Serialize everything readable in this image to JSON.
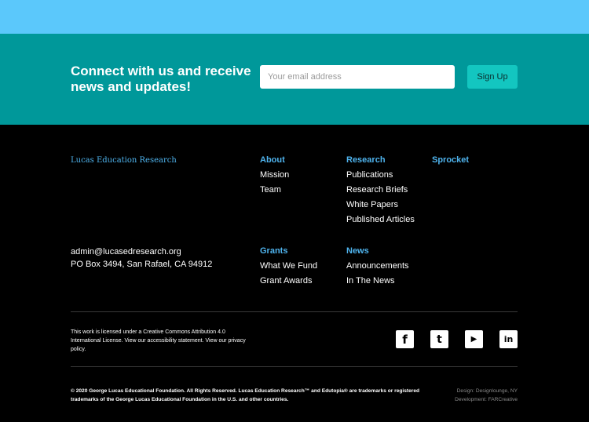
{
  "signup": {
    "headline": "Connect with us and receive news and updates!",
    "email_placeholder": "Your email address",
    "button_label": "Sign Up"
  },
  "brand": {
    "name": "Lucas Education Research"
  },
  "contact": {
    "email": "admin@lucasedresearch.org",
    "address": "PO Box 3494, San Rafael, CA 94912"
  },
  "nav": {
    "about": {
      "heading": "About",
      "links": [
        "Mission",
        "Team"
      ]
    },
    "research": {
      "heading": "Research",
      "links": [
        "Publications",
        "Research Briefs",
        "White Papers",
        "Published Articles"
      ]
    },
    "sprocket": {
      "heading": "Sprocket"
    },
    "grants": {
      "heading": "Grants",
      "links": [
        "What We Fund",
        "Grant Awards"
      ]
    },
    "news": {
      "heading": "News",
      "links": [
        "Announcements",
        "In The News"
      ]
    }
  },
  "license": {
    "text_1": "This work is licensed under a Creative Commons Attribution 4.0 International License. View our ",
    "accessibility_link": "accessibility statement",
    "text_2": ". View our ",
    "privacy_link": "privacy policy",
    "text_3": "."
  },
  "social": {
    "facebook_glyph": "f",
    "twitter_glyph": "t",
    "youtube_glyph": "▶",
    "linkedin_glyph": "in"
  },
  "legal": {
    "copyright": "© 2020 George Lucas Educational Foundation. All Rights Reserved. Lucas Education Research™ and Edutopia® are trademarks or registered trademarks of the George Lucas Educational Foundation in the U.S. and other countries."
  },
  "credits": {
    "design": "Design: Designlounge, NY",
    "development": "Development: FARCreative"
  },
  "colors": {
    "top_band": "#5bc8fb",
    "signup_band": "#00989a",
    "signup_button": "#13c6c0",
    "link_accent": "#4fb4ee",
    "footer_bg": "#000000"
  }
}
